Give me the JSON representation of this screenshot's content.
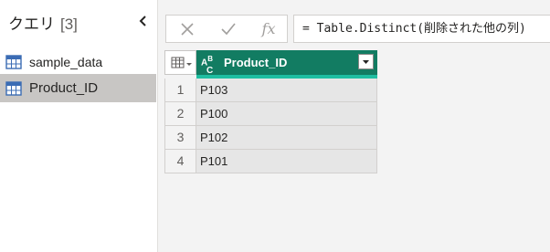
{
  "query_pane": {
    "title": "クエリ",
    "count": "[3]",
    "items": [
      {
        "label": "sample_data",
        "selected": false
      },
      {
        "label": "Product_ID",
        "selected": true
      }
    ]
  },
  "formula_bar": {
    "fx_label": "fx",
    "formula": "= Table.Distinct(削除された他の列)"
  },
  "grid": {
    "column": {
      "name": "Product_ID",
      "type_icon": "text-type-icon"
    },
    "rows": [
      {
        "index": "1",
        "value": "P103"
      },
      {
        "index": "2",
        "value": "P100"
      },
      {
        "index": "3",
        "value": "P102"
      },
      {
        "index": "4",
        "value": "P101"
      }
    ]
  },
  "colors": {
    "header_accent": "#127c62",
    "quality_bar": "#1fbea1",
    "selected_item": "#c8c6c4"
  }
}
